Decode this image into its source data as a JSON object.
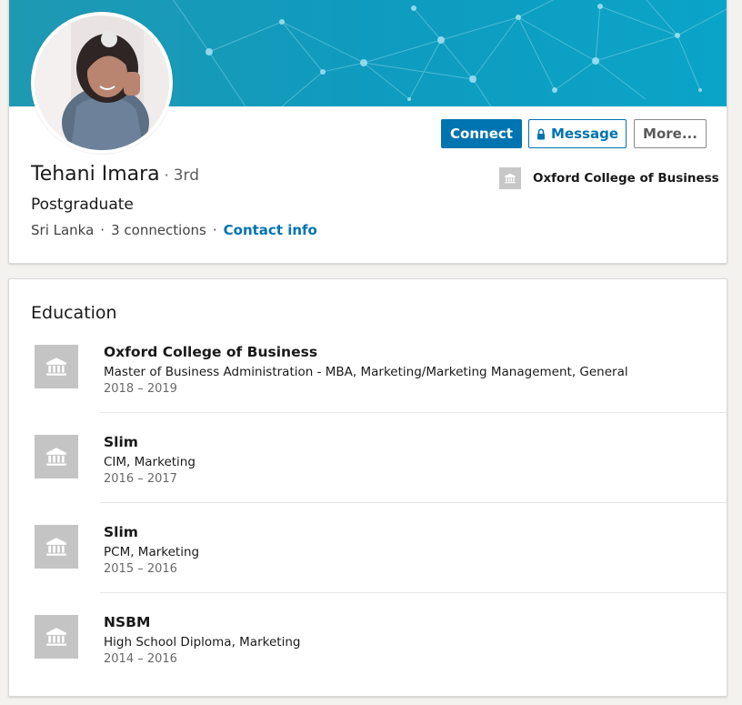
{
  "colors": {
    "accent": "#0073b1",
    "banner_start": "#1e9bb3",
    "banner_end": "#0aa2c6"
  },
  "profile": {
    "name": "Tehani Imara",
    "degree": "3rd",
    "headline": "Postgraduate",
    "location": "Sri Lanka",
    "connections": "3 connections",
    "contact_info": "Contact info",
    "current_school": "Oxford College of Business"
  },
  "actions": {
    "connect": "Connect",
    "message": "Message",
    "more": "More..."
  },
  "education": {
    "title": "Education",
    "items": [
      {
        "school": "Oxford College of Business",
        "degree": "Master of Business Administration - MBA, Marketing/Marketing Management, General",
        "dates": "2018 – 2019",
        "icon": "school-icon"
      },
      {
        "school": "Slim",
        "degree": "CIM, Marketing",
        "dates": "2016 – 2017",
        "icon": "school-icon"
      },
      {
        "school": "Slim",
        "degree": "PCM, Marketing",
        "dates": "2015 – 2016",
        "icon": "school-icon"
      },
      {
        "school": "NSBM",
        "degree": "High School Diploma, Marketing",
        "dates": "2014 – 2016",
        "icon": "school-icon"
      }
    ]
  }
}
